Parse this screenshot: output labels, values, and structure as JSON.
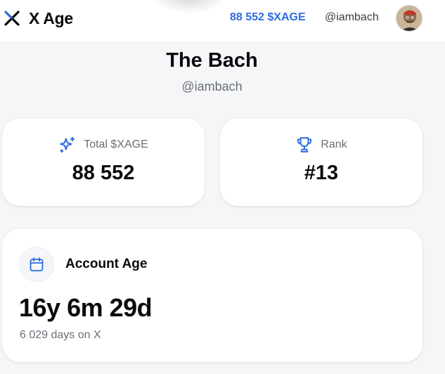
{
  "header": {
    "app_name": "X Age",
    "balance": "88 552 $XAGE",
    "handle": "@iambach",
    "avatar_alt": "avatar"
  },
  "profile": {
    "name": "The Bach",
    "handle": "@iambach"
  },
  "stats": {
    "total": {
      "label": "Total $XAGE",
      "value": "88 552",
      "icon": "sparkles-icon"
    },
    "rank": {
      "label": "Rank",
      "value": "#13",
      "icon": "trophy-icon"
    }
  },
  "account_age": {
    "title": "Account Age",
    "value": "16y 6m 29d",
    "days": "6 029 days on X",
    "icon": "calendar-icon"
  },
  "colors": {
    "accent": "#2d6cdf",
    "muted": "#6a6e76",
    "background": "#f5f6f8"
  }
}
